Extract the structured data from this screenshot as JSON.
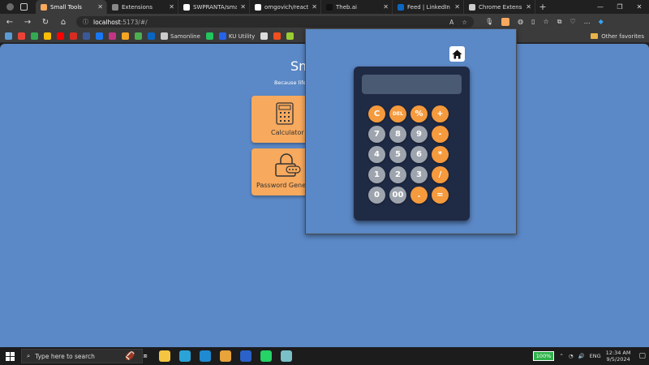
{
  "tabs": [
    {
      "title": "Small Tools",
      "color": "#f7a95e",
      "active": true
    },
    {
      "title": "Extensions",
      "color": "#888888",
      "active": false
    },
    {
      "title": "SWPRANTA/small-tools",
      "color": "#ffffff",
      "active": false
    },
    {
      "title": "omgovich/react-colorful",
      "color": "#ffffff",
      "active": false
    },
    {
      "title": "Theb.ai",
      "color": "#111111",
      "active": false
    },
    {
      "title": "Feed | LinkedIn",
      "color": "#0a66c2",
      "active": false
    },
    {
      "title": "Chrome Extension AI",
      "color": "#cccccc",
      "active": false
    }
  ],
  "address_bar": {
    "host": "localhost",
    "path": ":5173/#/"
  },
  "bookmarks": {
    "items": [
      {
        "label": "",
        "color": "#5b9bd5"
      },
      {
        "label": "",
        "color": "#ea4335"
      },
      {
        "label": "",
        "color": "#34a853"
      },
      {
        "label": "",
        "color": "#fbbc05"
      },
      {
        "label": "",
        "color": "#ff0000"
      },
      {
        "label": "",
        "color": "#d62d20"
      },
      {
        "label": "",
        "color": "#3b5998"
      },
      {
        "label": "",
        "color": "#1877f2"
      },
      {
        "label": "",
        "color": "#c13584"
      },
      {
        "label": "",
        "color": "#f5a623"
      },
      {
        "label": "",
        "color": "#4caf50"
      },
      {
        "label": "",
        "color": "#0a66c2"
      },
      {
        "label": "Samonline",
        "color": "#cccccc"
      },
      {
        "label": "",
        "color": "#22c55e"
      },
      {
        "label": "KU Utility",
        "color": "#2563eb"
      },
      {
        "label": "",
        "color": "#dddddd"
      },
      {
        "label": "",
        "color": "#f24e1e"
      },
      {
        "label": "",
        "color": "#9acd32"
      }
    ],
    "other": "Other favorites"
  },
  "page": {
    "heading": "Sm",
    "subtitle": "Because life",
    "cards": [
      {
        "label": "Calculator"
      },
      {
        "label": "Password Gener"
      }
    ]
  },
  "calculator": {
    "display": "",
    "keys": [
      {
        "label": "C",
        "style": "orange"
      },
      {
        "label": "DEL",
        "style": "orange"
      },
      {
        "label": "%",
        "style": "orange"
      },
      {
        "label": "+",
        "style": "orange"
      },
      {
        "label": "7",
        "style": "grey"
      },
      {
        "label": "8",
        "style": "grey"
      },
      {
        "label": "9",
        "style": "grey"
      },
      {
        "label": "-",
        "style": "orange"
      },
      {
        "label": "4",
        "style": "grey"
      },
      {
        "label": "5",
        "style": "grey"
      },
      {
        "label": "6",
        "style": "grey"
      },
      {
        "label": "*",
        "style": "orange"
      },
      {
        "label": "1",
        "style": "grey"
      },
      {
        "label": "2",
        "style": "grey"
      },
      {
        "label": "3",
        "style": "grey"
      },
      {
        "label": "/",
        "style": "orange"
      },
      {
        "label": "0",
        "style": "grey"
      },
      {
        "label": "00",
        "style": "grey"
      },
      {
        "label": ".",
        "style": "orange"
      },
      {
        "label": "=",
        "style": "orange"
      }
    ]
  },
  "taskbar": {
    "search_placeholder": "Type here to search",
    "apps": [
      {
        "name": "file-explorer-icon",
        "color": "#f5c542"
      },
      {
        "name": "edge-icon",
        "color": "#2aa4d8"
      },
      {
        "name": "vscode-icon",
        "color": "#1f8ad2"
      },
      {
        "name": "app-icon",
        "color": "#e8a33a"
      },
      {
        "name": "magnifier-app-icon",
        "color": "#2a62c9"
      },
      {
        "name": "whatsapp-icon",
        "color": "#25d366"
      },
      {
        "name": "app2-icon",
        "color": "#7ac0c8"
      }
    ],
    "battery": "100%",
    "language": "ENG",
    "time": "12:34 AM",
    "date": "9/5/2024"
  },
  "colors": {
    "page_bg": "#5b88c6",
    "card_bg": "#f7a95e",
    "calc_body": "#1f2a44",
    "key_orange": "#f59a3d",
    "key_grey": "#9ea4ad"
  }
}
